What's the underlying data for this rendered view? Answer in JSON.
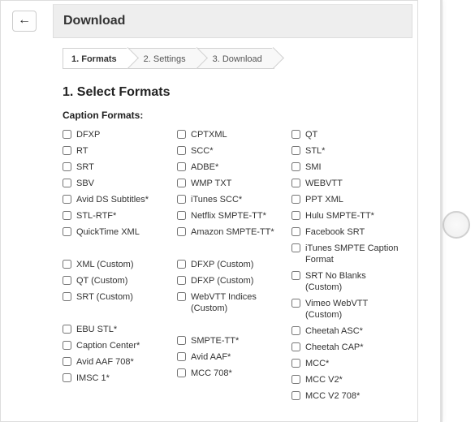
{
  "header": {
    "title": "Download"
  },
  "back_label": "←",
  "steps": [
    {
      "label": "1. Formats",
      "active": true
    },
    {
      "label": "2. Settings",
      "active": false
    },
    {
      "label": "3. Download",
      "active": false
    }
  ],
  "section_title": "1. Select Formats",
  "subheading": "Caption Formats:",
  "columns": [
    [
      "DFXP",
      "RT",
      "SRT",
      "SBV",
      "Avid DS Subtitles*",
      "STL-RTF*",
      "QuickTime XML",
      "",
      "XML (Custom)",
      "QT (Custom)",
      "SRT (Custom)",
      "",
      "EBU STL*",
      "Caption Center*",
      "Avid AAF 708*",
      "IMSC 1*"
    ],
    [
      "CPTXML",
      "SCC*",
      "ADBE*",
      "WMP TXT",
      "iTunes SCC*",
      "Netflix SMPTE-TT*",
      "Amazon SMPTE-TT*",
      "",
      "DFXP (Custom)",
      "DFXP (Custom)",
      "WebVTT Indices (Custom)",
      "",
      "SMPTE-TT*",
      "Avid AAF*",
      "MCC 708*",
      ""
    ],
    [
      "QT",
      "STL*",
      "SMI",
      "WEBVTT",
      "PPT XML",
      "Hulu SMPTE-TT*",
      "Facebook SRT",
      "iTunes SMPTE Caption Format",
      "SRT No Blanks (Custom)",
      "Vimeo WebVTT (Custom)",
      "Cheetah ASC*",
      "Cheetah CAP*",
      "MCC*",
      "MCC V2*",
      "MCC V2 708*",
      ""
    ]
  ]
}
